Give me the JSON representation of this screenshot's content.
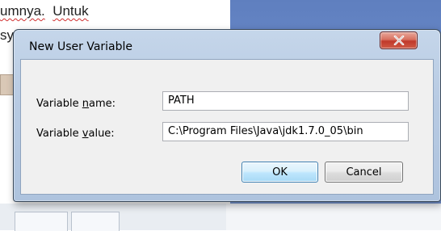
{
  "background": {
    "doc_line1_word1": "umnya.",
    "doc_line1_word2": "Untuk",
    "doc_line2": "sys"
  },
  "dialog": {
    "title": "New User Variable",
    "close_icon": "close-x-icon",
    "name_label_pre": "Variable ",
    "name_label_ul": "n",
    "name_label_post": "ame:",
    "value_label_pre": "Variable ",
    "value_label_ul": "v",
    "value_label_post": "alue:",
    "name_value": "PATH",
    "value_value": "C:\\Program Files\\Java\\jdk1.7.0_05\\bin",
    "ok_label": "OK",
    "cancel_label": "Cancel"
  },
  "colors": {
    "close_button": "#c0392b",
    "window_frame": "#b8cbe3",
    "desktop_blue": "#6c8ccb"
  }
}
